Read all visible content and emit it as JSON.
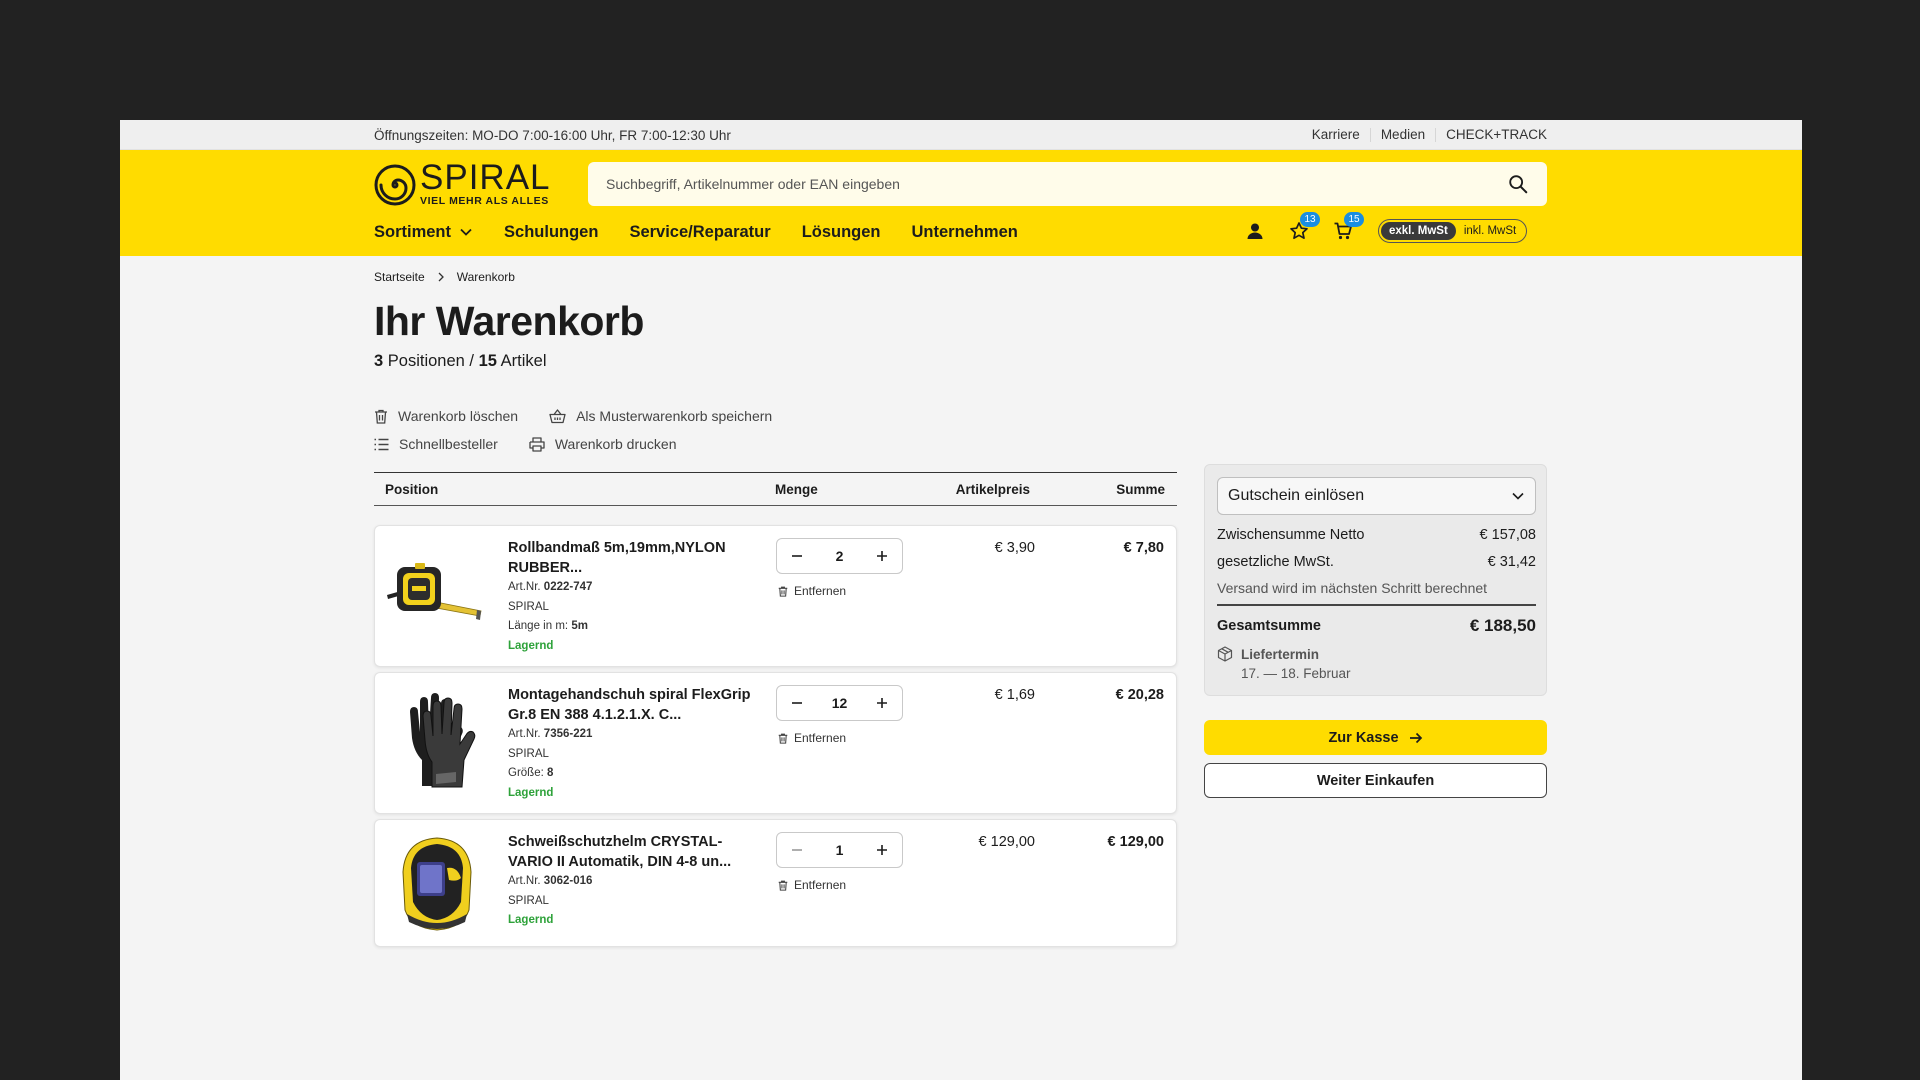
{
  "topbar": {
    "hours": "Öffnungszeiten: MO-DO 7:00-16:00 Uhr, FR 7:00-12:30 Uhr",
    "links": [
      "Karriere",
      "Medien",
      "CHECK+TRACK"
    ]
  },
  "brand": {
    "name": "SPIRAL",
    "tagline": "VIEL MEHR ALS ALLES",
    "accent_color": "#ffdc00"
  },
  "search": {
    "placeholder": "Suchbegriff, Artikelnummer oder EAN eingeben"
  },
  "nav": [
    "Sortiment",
    "Schulungen",
    "Service/Reparatur",
    "Lösungen",
    "Unternehmen"
  ],
  "tools": {
    "wishlist_count": "13",
    "cart_count": "15",
    "vat_active": "exkl. MwSt",
    "vat_inactive": "inkl. MwSt"
  },
  "breadcrumb": [
    "Startseite",
    "Warenkorb"
  ],
  "title": "Ihr Warenkorb",
  "counts": {
    "positions": "3",
    "positions_label": "Positionen /",
    "articles": "15",
    "articles_label": "Artikel"
  },
  "actions": {
    "clear": "Warenkorb löschen",
    "save": "Als Musterwarenkorb speichern",
    "quick": "Schnellbesteller",
    "print": "Warenkorb drucken"
  },
  "table": {
    "headers": {
      "position": "Position",
      "qty": "Menge",
      "unit_price": "Artikelpreis",
      "total": "Summe"
    },
    "remove_label": "Entfernen",
    "artnr_label": "Art.Nr.",
    "items": [
      {
        "name": "Rollbandmaß 5m,19mm,NYLON RUBBER...",
        "artnr": "0222-747",
        "brand": "SPIRAL",
        "attr_label": "Länge in m:",
        "attr_value": "5m",
        "stock": "Lagernd",
        "qty": "2",
        "unit_price": "€ 3,90",
        "total": "€ 7,80"
      },
      {
        "name": "Montagehandschuh spiral FlexGrip Gr.8 EN 388 4.1.2.1.X. C...",
        "artnr": "7356-221",
        "brand": "SPIRAL",
        "attr_label": "Größe:",
        "attr_value": "8",
        "stock": "Lagernd",
        "qty": "12",
        "unit_price": "€ 1,69",
        "total": "€ 20,28"
      },
      {
        "name": "Schweißschutzhelm CRYSTAL-VARIO II Automatik, DIN 4-8 un...",
        "artnr": "3062-016",
        "brand": "SPIRAL",
        "stock": "Lagernd",
        "qty": "1",
        "unit_price": "€ 129,00",
        "total": "€ 129,00"
      }
    ]
  },
  "summary": {
    "coupon": "Gutschein einlösen",
    "subtotal_label": "Zwischensumme Netto",
    "subtotal": "€ 157,08",
    "vat_label": "gesetzliche MwSt.",
    "vat": "€ 31,42",
    "shipping_note": "Versand wird im nächsten Schritt berechnet",
    "total_label": "Gesamtsumme",
    "total": "€ 188,50",
    "delivery_label": "Liefertermin",
    "delivery_date": "17. — 18. Februar"
  },
  "buttons": {
    "checkout": "Zur Kasse",
    "continue": "Weiter Einkaufen"
  }
}
